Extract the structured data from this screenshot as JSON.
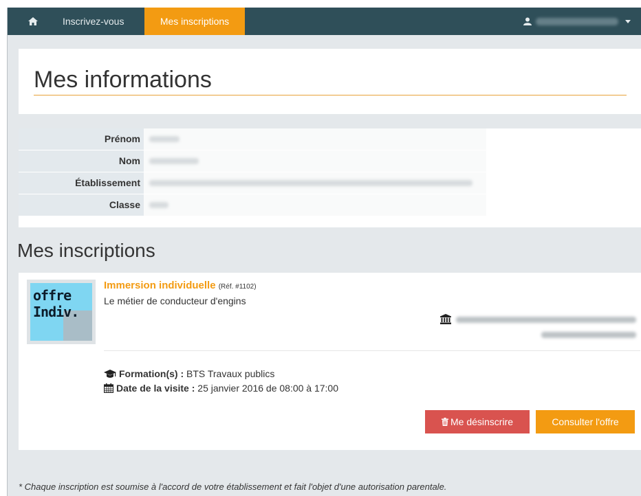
{
  "nav": {
    "home_icon": "home-icon",
    "links": [
      "Inscrivez-vous",
      "Mes inscriptions"
    ],
    "user_icon": "user-icon"
  },
  "info": {
    "title": "Mes informations",
    "rows": [
      {
        "label": "Prénom"
      },
      {
        "label": "Nom"
      },
      {
        "label": "Établissement"
      },
      {
        "label": "Classe"
      }
    ]
  },
  "inscriptions": {
    "title": "Mes inscriptions",
    "items": [
      {
        "thumb_line1": "offre",
        "thumb_line2": "Indiv.",
        "type": "Immersion individuelle",
        "ref": "(Réf. #1102)",
        "subtitle": "Le métier de conducteur d'engins",
        "formation_label": "Formation(s) :",
        "formation_value": "BTS Travaux publics",
        "date_label": "Date de la visite :",
        "date_value": "25 janvier 2016 de 08:00 à 17:00",
        "unsubscribe_label": "Me désinscrire",
        "view_label": "Consulter l'offre"
      }
    ]
  },
  "footnote": "* Chaque inscription est soumise à l'accord de votre établissement et fait l'objet d'une autorisation parentale.",
  "colors": {
    "navbar": "#2f4f59",
    "accent": "#f39b12",
    "danger": "#d9534f"
  }
}
